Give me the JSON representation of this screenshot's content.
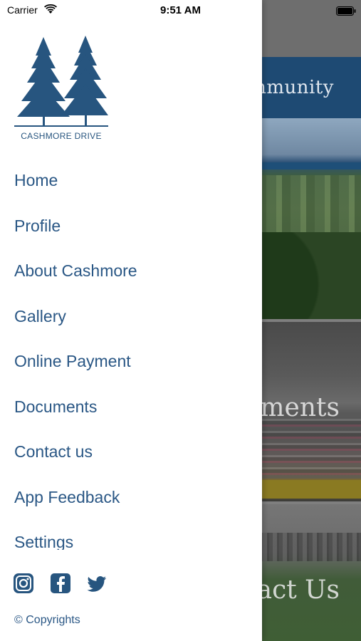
{
  "status_bar": {
    "carrier": "Carrier",
    "time": "9:51 AM",
    "wifi_icon": "wifi-icon",
    "battery_icon": "battery-icon"
  },
  "logo": {
    "text": "CASHMORE DRIVE",
    "icon": "pine-trees-icon"
  },
  "menu": {
    "items": [
      {
        "label": "Home"
      },
      {
        "label": "Profile"
      },
      {
        "label": "About Cashmore"
      },
      {
        "label": "Gallery"
      },
      {
        "label": "Online Payment"
      },
      {
        "label": "Documents"
      },
      {
        "label": "Contact us"
      },
      {
        "label": "App Feedback"
      },
      {
        "label": "Settings"
      }
    ]
  },
  "social": {
    "items": [
      {
        "icon": "instagram-icon"
      },
      {
        "icon": "facebook-icon"
      },
      {
        "icon": "twitter-icon"
      }
    ]
  },
  "copyright": "© Copyrights",
  "background": {
    "header_title": "mmunity",
    "tiles": [
      {
        "title": ""
      },
      {
        "title": "uments"
      },
      {
        "title": "tact Us"
      }
    ]
  },
  "colors": {
    "brand_blue": "#2a5785",
    "header_blue": "#1e4a73",
    "drawer_bg": "#ffffff"
  }
}
